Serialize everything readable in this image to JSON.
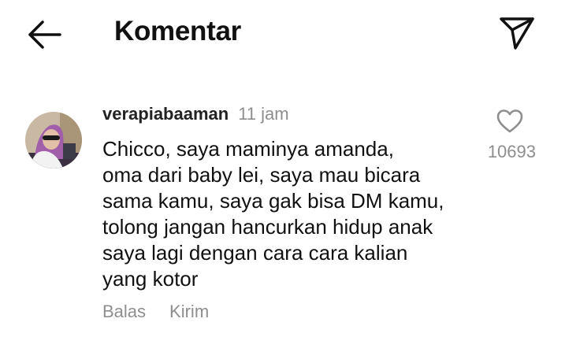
{
  "header": {
    "back_icon": "arrow-left-icon",
    "title": "Komentar",
    "send_icon": "paper-plane-icon"
  },
  "comment": {
    "username": "verapiabaaman",
    "time": "11 jam",
    "lines": [
      "Chicco, saya maminya amanda,",
      "oma dari baby lei, saya mau bicara",
      "sama kamu, saya gak bisa DM kamu,",
      "tolong jangan hancurkan hidup anak",
      "saya lagi dengan cara cara kalian",
      "yang kotor"
    ],
    "reply_label": "Balas",
    "send_label": "Kirim",
    "like_icon": "heart-outline-icon",
    "like_count": "10693"
  },
  "colors": {
    "text": "#111111",
    "secondary": "#8e8e8e",
    "background": "#ffffff"
  }
}
